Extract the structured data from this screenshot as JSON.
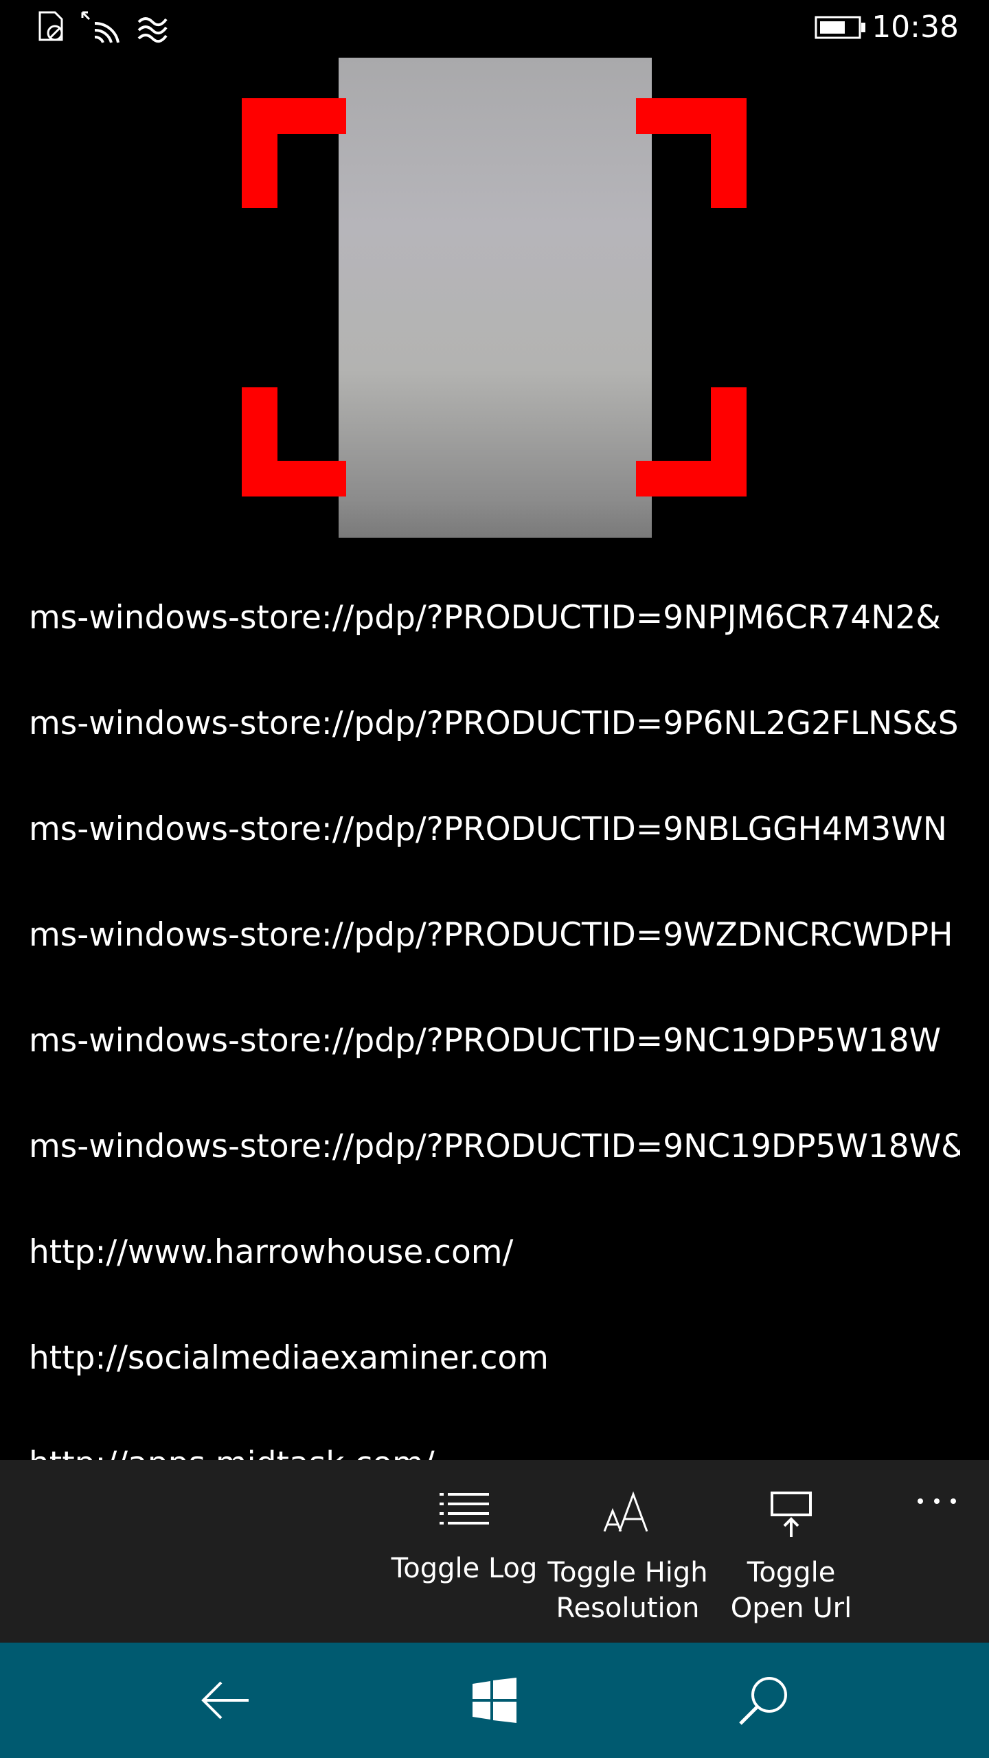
{
  "status_bar": {
    "time": "10:38",
    "icons": [
      "sim-no-service-icon",
      "wifi-icon",
      "cellular-signal-icon",
      "battery-icon"
    ]
  },
  "scanner": {
    "frame_color": "#ff0000"
  },
  "log": {
    "items": [
      "ms-windows-store://pdp/?PRODUCTID=9NPJM6CR74N2&",
      "ms-windows-store://pdp/?PRODUCTID=9P6NL2G2FLNS&S",
      "ms-windows-store://pdp/?PRODUCTID=9NBLGGH4M3WN",
      "ms-windows-store://pdp/?PRODUCTID=9WZDNCRCWDPH",
      "ms-windows-store://pdp/?PRODUCTID=9NC19DP5W18W",
      "ms-windows-store://pdp/?PRODUCTID=9NC19DP5W18W&",
      "http://www.harrowhouse.com/",
      "http://socialmediaexaminer.com",
      "http://apps.midtask.com/"
    ]
  },
  "app_bar": {
    "buttons": [
      {
        "label": "Toggle Log",
        "icon": "list-icon"
      },
      {
        "label": "Toggle High Resolution",
        "icon": "font-size-icon"
      },
      {
        "label": "Toggle Open Url",
        "icon": "open-url-icon"
      }
    ],
    "more_icon": "more-icon",
    "background": "#1f1f1f"
  },
  "nav_bar": {
    "background": "#005a70",
    "icons": [
      "back-arrow-icon",
      "windows-start-icon",
      "search-icon"
    ]
  }
}
